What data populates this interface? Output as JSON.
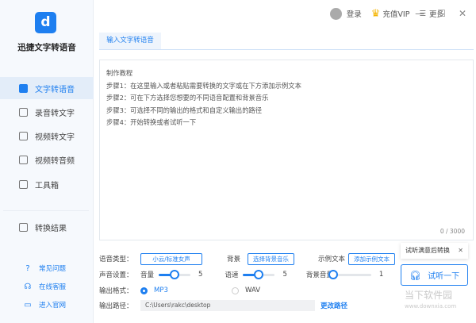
{
  "app": {
    "name": "迅捷文字转语音",
    "logo_glyph": "d"
  },
  "sidebar": {
    "items": [
      {
        "label": "文字转语音",
        "active": true
      },
      {
        "label": "录音转文字"
      },
      {
        "label": "视频转文字"
      },
      {
        "label": "视频转音频"
      },
      {
        "label": "工具箱"
      },
      {
        "label": "转换结果"
      }
    ],
    "links": [
      {
        "label": "常见问题",
        "icon": "?"
      },
      {
        "label": "在线客服",
        "icon": "☊"
      },
      {
        "label": "进入官网",
        "icon": "▭"
      }
    ]
  },
  "topbar": {
    "login": "登录",
    "vip": "充值VIP",
    "more": "更多",
    "minimize": "—",
    "maximize": "☐",
    "close": "✕"
  },
  "tab": "输入文字转语音",
  "editor": {
    "lines": [
      "制作教程",
      "步骤1：在这里输入或者粘贴需要转换的文字或在下方添加示例文本",
      "步骤2：可在下方选择您想要的不同语音配置和背景音乐",
      "步骤3：可选择不同的输出的格式和自定义输出的路径",
      "步骤4：开始转换或者试听一下"
    ],
    "counter": "0 / 3000"
  },
  "settings": {
    "voice_type_label": "语音类型：",
    "voice_type": "小云/标准女声",
    "bg_label": "背景",
    "bg_button": "选择背景音乐",
    "sample_label": "示例文本",
    "sample_button": "添加示例文本",
    "sound_label": "声音设置：",
    "volume_label": "音量",
    "volume": 5,
    "speed_label": "语速",
    "speed": 5,
    "bg_volume_label": "背景音量",
    "bg_volume": 1,
    "format_label": "输出格式：",
    "formats": [
      "MP3",
      "WAV"
    ],
    "format_selected": "MP3",
    "path_label": "输出路径：",
    "path": "C:\\Users\\rakc\\desktop",
    "change_path": "更改路径"
  },
  "tooltip": {
    "text": "试听满意后转换",
    "close": "✕"
  },
  "listen_button": "试听一下",
  "watermark": {
    "name": "当下软件园",
    "url": "www.downxia.com"
  }
}
